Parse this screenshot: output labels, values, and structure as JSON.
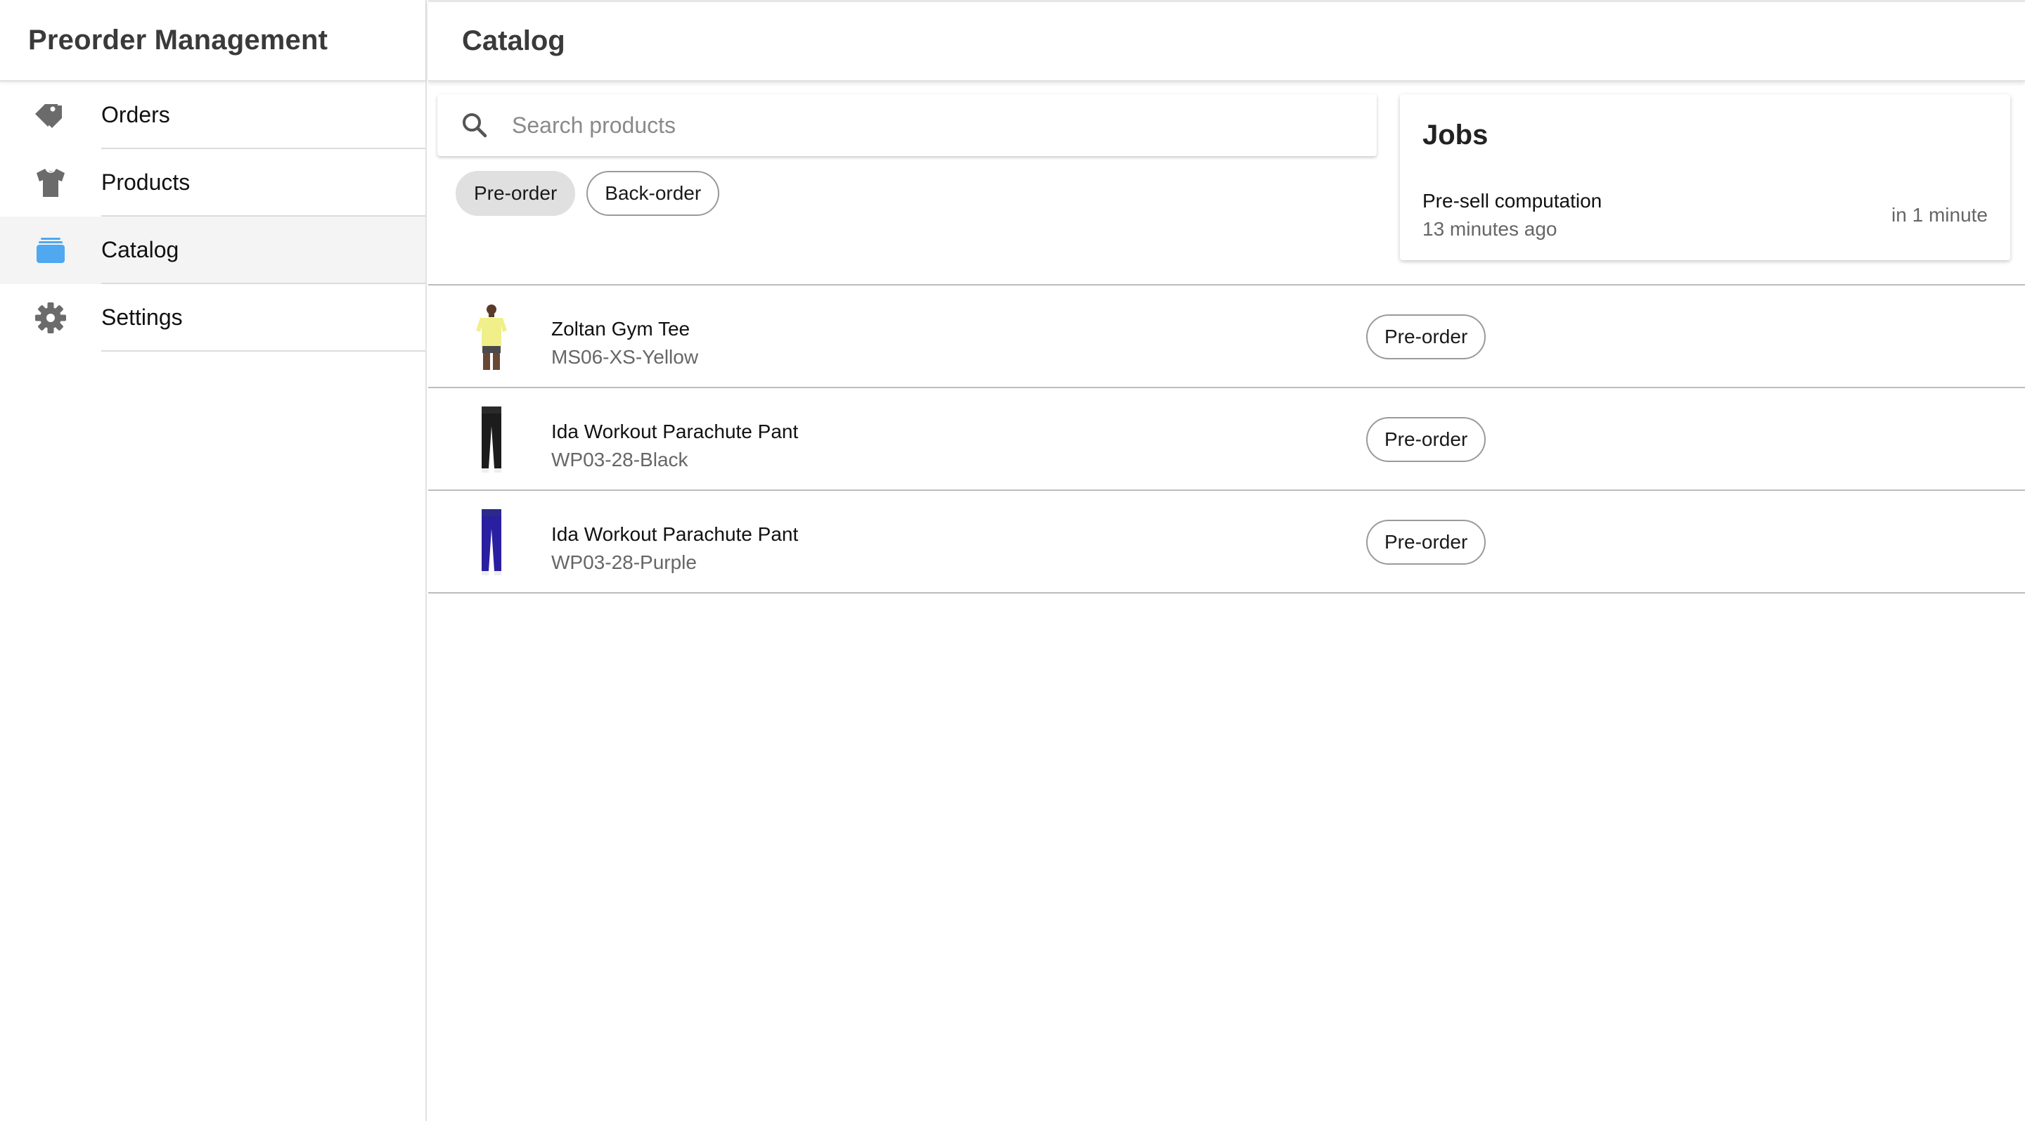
{
  "app": {
    "title": "Preorder Management"
  },
  "sidebar": {
    "items": [
      {
        "label": "Orders",
        "icon": "pricetags-icon",
        "active": false
      },
      {
        "label": "Products",
        "icon": "shirt-icon",
        "active": false
      },
      {
        "label": "Catalog",
        "icon": "albums-icon",
        "active": true
      },
      {
        "label": "Settings",
        "icon": "settings-icon",
        "active": false
      }
    ]
  },
  "header": {
    "title": "Catalog"
  },
  "search": {
    "placeholder": "Search products",
    "value": ""
  },
  "filters": [
    {
      "label": "Pre-order",
      "selected": true
    },
    {
      "label": "Back-order",
      "selected": false
    }
  ],
  "jobs": {
    "title": "Jobs",
    "items": [
      {
        "name": "Pre-sell computation",
        "last_run": "13 minutes ago",
        "next_run": "in 1 minute"
      }
    ]
  },
  "products": [
    {
      "name": "Zoltan Gym Tee",
      "sku": "MS06-XS-Yellow",
      "status": "Pre-order",
      "thumbnail": "yellow-tee"
    },
    {
      "name": "Ida Workout Parachute Pant",
      "sku": "WP03-28-Black",
      "status": "Pre-order",
      "thumbnail": "black-pant"
    },
    {
      "name": "Ida Workout Parachute Pant",
      "sku": "WP03-28-Purple",
      "status": "Pre-order",
      "thumbnail": "purple-pant"
    }
  ],
  "colors": {
    "icon_gray": "#6b6b6b",
    "accent_blue": "#4fa8f0",
    "active_bg": "#f4f4f4",
    "chip_selected": "#e0e0e0"
  }
}
